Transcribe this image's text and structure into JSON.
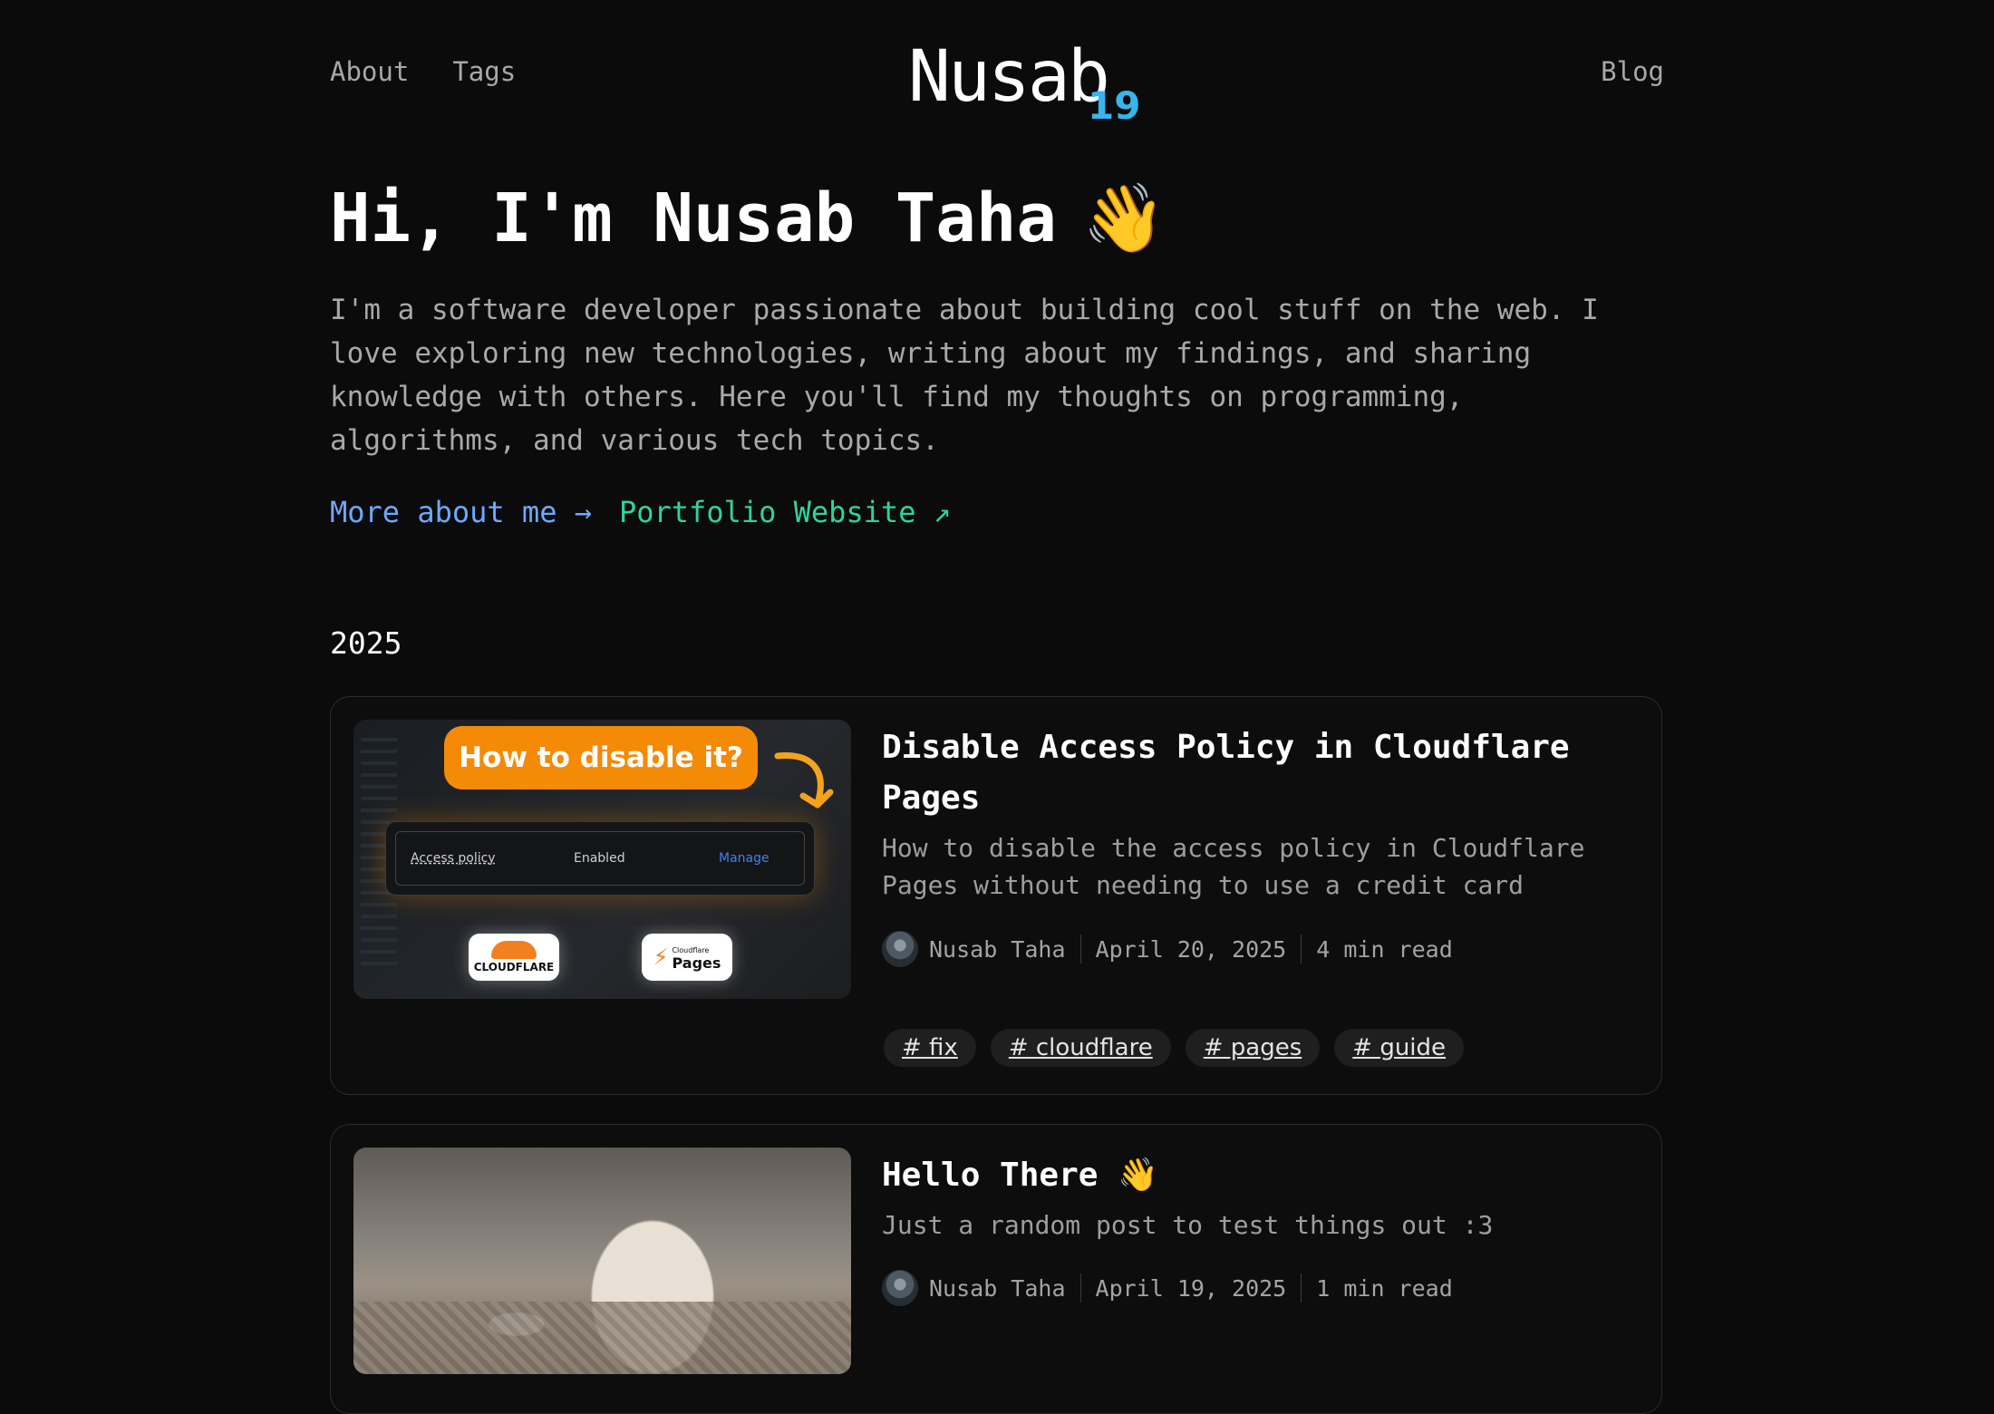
{
  "nav": {
    "left": [
      "About",
      "Tags"
    ],
    "right": "Blog",
    "logo_main": "Nusab",
    "logo_sup": "19"
  },
  "hero": {
    "title": "Hi, I'm Nusab Taha",
    "wave": "👋",
    "description": "I'm a software developer passionate about building cool stuff on the web. I love exploring new technologies, writing about my findings, and sharing knowledge with others. Here you'll find my thoughts on programming, algorithms, and various tech topics.",
    "link_about": "More about me →",
    "link_portfolio": "Portfolio Website ↗"
  },
  "year": "2025",
  "posts": [
    {
      "title": "Disable Access Policy in Cloudflare Pages",
      "description": "How to disable the access policy in Cloudflare Pages without needing to use a credit card",
      "author": "Nusab Taha",
      "date": "April 20, 2025",
      "read_time": "4 min read",
      "tags": [
        "# fix",
        "# cloudflare",
        "# pages",
        "# guide"
      ],
      "thumb": {
        "headline": "How to disable it?",
        "policy_label": "Access policy",
        "policy_status": "Enabled",
        "policy_action": "Manage",
        "badge_left": "CLOUDFLARE",
        "badge_right": "Pages",
        "badge_right_small": "Cloudflare"
      }
    },
    {
      "title": "Hello There 👋",
      "description": "Just a random post to test things out :3",
      "author": "Nusab Taha",
      "date": "April 19, 2025",
      "read_time": "1 min read",
      "tags": []
    }
  ],
  "colors": {
    "background": "#0b0b0b",
    "link_blue": "#6ea8ff",
    "link_green": "#2ed3a0",
    "logo_accent": "#35b6ee",
    "thumb_orange": "#f58a07"
  }
}
